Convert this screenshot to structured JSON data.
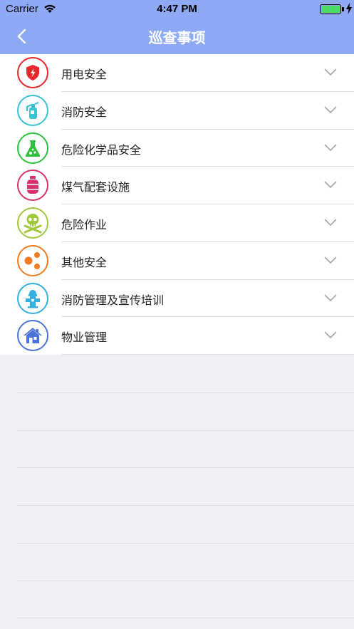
{
  "status": {
    "carrier": "Carrier",
    "time": "4:47 PM"
  },
  "nav": {
    "title": "巡查事项",
    "back_icon": "chevron-left-icon"
  },
  "items": [
    {
      "label": "用电安全",
      "icon": "electric-shield-icon",
      "color": "#e8262c"
    },
    {
      "label": "消防安全",
      "icon": "fire-extinguisher-icon",
      "color": "#39c4d3"
    },
    {
      "label": "危险化学品安全",
      "icon": "chemical-flask-icon",
      "color": "#2ec13b"
    },
    {
      "label": "煤气配套设施",
      "icon": "gas-cylinder-icon",
      "color": "#d6306f"
    },
    {
      "label": "危险作业",
      "icon": "skull-crossbones-icon",
      "color": "#a0c83c"
    },
    {
      "label": "其他安全",
      "icon": "share-dots-icon",
      "color": "#f07b20"
    },
    {
      "label": "消防管理及宣传培训",
      "icon": "fire-hydrant-icon",
      "color": "#36b0e0"
    },
    {
      "label": "物业管理",
      "icon": "house-icon",
      "color": "#4a73d8"
    }
  ],
  "colors": {
    "nav_background": "#8eaaf5",
    "page_background": "#efeff4",
    "battery": "#4cd964"
  }
}
